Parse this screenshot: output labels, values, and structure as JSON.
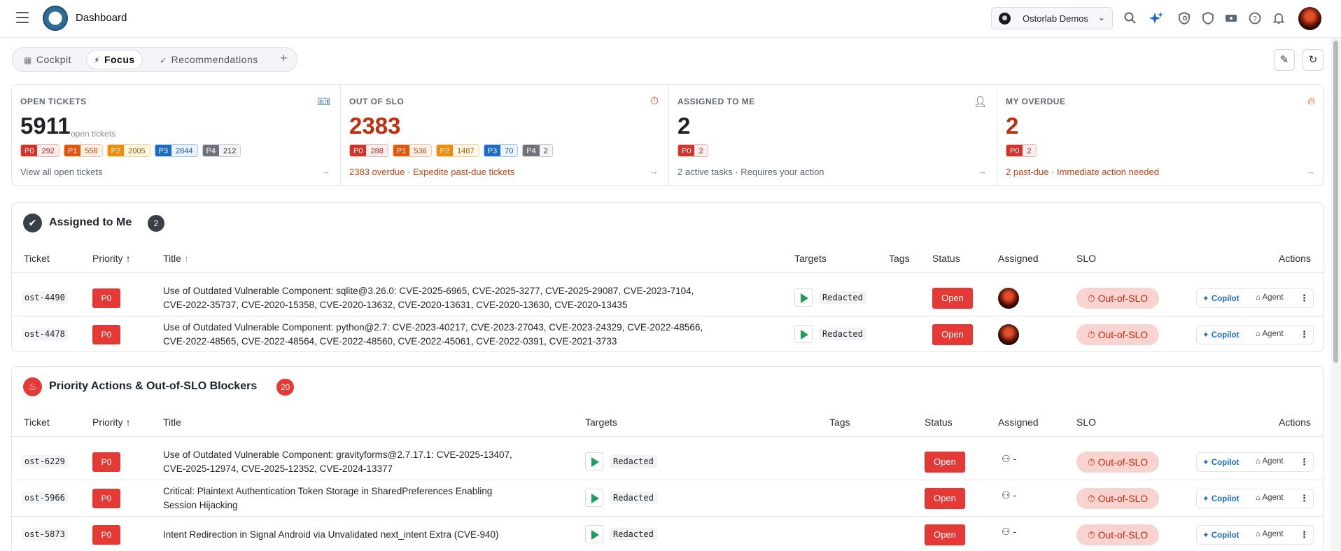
{
  "header": {
    "title": "Dashboard",
    "org": "Ostorlab Demos",
    "icons": [
      "menu-icon",
      "search-icon",
      "sparkle-icon",
      "shield-search-icon",
      "shield-icon",
      "ticket-icon",
      "help-icon",
      "bell-icon"
    ]
  },
  "tabs": [
    {
      "label": "Cockpit",
      "icon": "grid-icon",
      "active": false
    },
    {
      "label": "Focus",
      "icon": "bolt-icon",
      "active": true
    },
    {
      "label": "Recommendations",
      "icon": "rocket-icon",
      "active": false
    }
  ],
  "tab_add": "+",
  "kpis": [
    {
      "label": "OPEN TICKETS",
      "icon": "ticket-icon",
      "value": "5911",
      "sub": "open tickets",
      "pills": [
        [
          "P0",
          "292"
        ],
        [
          "P1",
          "558"
        ],
        [
          "P2",
          "2005"
        ],
        [
          "P3",
          "2844"
        ],
        [
          "P4",
          "212"
        ]
      ],
      "footer": "View all open tickets",
      "footer_red": false,
      "value_red": false
    },
    {
      "label": "OUT OF SLO",
      "icon": "timer-icon",
      "value": "2383",
      "sub": "",
      "pills": [
        [
          "P0",
          "288"
        ],
        [
          "P1",
          "536"
        ],
        [
          "P2",
          "1487"
        ],
        [
          "P3",
          "70"
        ],
        [
          "P4",
          "2"
        ]
      ],
      "footer": "2383 overdue · Expedite past-due tickets",
      "footer_red": true,
      "value_red": true
    },
    {
      "label": "ASSIGNED TO ME",
      "icon": "user-check-icon",
      "value": "2",
      "sub": "",
      "pills": [
        [
          "P0",
          "2"
        ]
      ],
      "footer": "2 active tasks · Requires your action",
      "footer_red": false,
      "value_red": false
    },
    {
      "label": "MY OVERDUE",
      "icon": "flame-icon",
      "value": "2",
      "sub": "",
      "pills": [
        [
          "P0",
          "2"
        ]
      ],
      "footer": "2 past-due · Immediate action needed",
      "footer_red": true,
      "value_red": true
    }
  ],
  "assigned": {
    "title": "Assigned to Me",
    "count": "2",
    "columns": {
      "ticket": "Ticket",
      "priority": "Priority",
      "title": "Title",
      "targets": "Targets",
      "tags": "Tags",
      "status": "Status",
      "assigned": "Assigned",
      "slo": "SLO",
      "actions": "Actions"
    },
    "rows": [
      {
        "ticket": "ost-4490",
        "priority": "P0",
        "title_l1": "Use of Outdated Vulnerable Component: sqlite@3.26.0: CVE-2025-6965, CVE-2025-3277, CVE-2025-29087, CVE-2023-7104,",
        "title_l2": "CVE-2022-35737, CVE-2020-15358, CVE-2020-13632, CVE-2020-13631, CVE-2020-13630, CVE-2020-13435",
        "target": "Redacted",
        "status": "Open",
        "slo": "Out-of-SLO"
      },
      {
        "ticket": "ost-4478",
        "priority": "P0",
        "title_l1": "Use of Outdated Vulnerable Component: python@2.7: CVE-2023-40217, CVE-2023-27043, CVE-2023-24329, CVE-2022-48566,",
        "title_l2": "CVE-2022-48565, CVE-2022-48564, CVE-2022-48560, CVE-2022-45061, CVE-2022-0391, CVE-2021-3733",
        "target": "Redacted",
        "status": "Open",
        "slo": "Out-of-SLO"
      }
    ]
  },
  "priority": {
    "title": "Priority Actions & Out-of-SLO Blockers",
    "count": "20",
    "rows": [
      {
        "ticket": "ost-6229",
        "priority": "P0",
        "title_l1": "Use of Outdated Vulnerable Component: gravityforms@2.7.17.1: CVE-2025-13407,",
        "title_l2": "CVE-2025-12974, CVE-2025-12352, CVE-2024-13377",
        "target": "Redacted",
        "status": "Open",
        "assignee": "-",
        "slo": "Out-of-SLO"
      },
      {
        "ticket": "ost-5966",
        "priority": "P0",
        "title_l1": "Critical: Plaintext Authentication Token Storage in SharedPreferences Enabling",
        "title_l2": "Session Hijacking",
        "target": "Redacted",
        "status": "Open",
        "assignee": "-",
        "slo": "Out-of-SLO"
      },
      {
        "ticket": "ost-5873",
        "priority": "P0",
        "title_l1": "Intent Redirection in Signal Android via Unvalidated next_intent Extra (CVE-940)",
        "title_l2": "",
        "target": "Redacted",
        "status": "Open",
        "assignee": "-",
        "slo": "Out-of-SLO"
      }
    ]
  },
  "actions": {
    "copilot": "Copilot",
    "agent": "Agent"
  },
  "colors": {
    "danger": "#e53935",
    "accent": "#1b6cc9",
    "overdue_text": "#c22d0c",
    "slo_bg": "#f8d3cf"
  }
}
